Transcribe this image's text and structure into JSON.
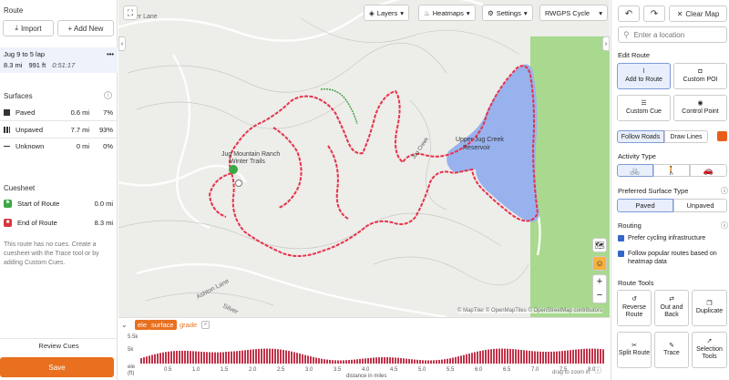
{
  "left": {
    "route_heading": "Route",
    "import_label": "Import",
    "add_new_label": "+ Add New",
    "route": {
      "name": "Jug 9 to 5 lap",
      "distance": "8.3 mi",
      "elevation": "991 ft",
      "time": "0:51:17",
      "menu": "•••"
    },
    "surfaces_heading": "Surfaces",
    "surfaces": [
      {
        "label": "Paved",
        "distance": "0.6 mi",
        "percent": "7%",
        "color": "#333333"
      },
      {
        "label": "Unpaved",
        "distance": "7.7 mi",
        "percent": "93%",
        "color": "#333333"
      },
      {
        "label": "Unknown",
        "distance": "0 mi",
        "percent": "0%",
        "color": "#333333"
      }
    ],
    "cuesheet_heading": "Cuesheet",
    "cues": [
      {
        "label": "Start of Route",
        "distance": "0.0 mi",
        "color": "#3aa845"
      },
      {
        "label": "End of Route",
        "distance": "8.3 mi",
        "color": "#d9363e"
      }
    ],
    "no_cues_text": "This route has no cues. Create a cuesheet with the Trace tool or by adding Custom Cues.",
    "review_cues_label": "Review Cues",
    "save_label": "Save"
  },
  "map": {
    "layers_label": "Layers",
    "heatmaps_label": "Heatmaps",
    "settings_label": "Settings",
    "map_style": "RWGPS Cycle",
    "labels": {
      "lane1": "ter Lane",
      "ranch": "Jug Mountain Ranch",
      "trails": "Winter Trails",
      "reservoir1": "Upper Jug Creek",
      "reservoir2": "Reservoir",
      "creek": "Jug Creek",
      "ashton": "Ashton Lane",
      "silver": "Silver"
    },
    "attribution": "© MapTiler © OpenMapTiles © OpenStreetMap contributors",
    "zoom_in": "+",
    "zoom_out": "−"
  },
  "elevation": {
    "tabs": [
      "ele",
      "surface",
      "grade"
    ],
    "y_ticks": [
      "5.5k",
      "5k"
    ],
    "y_unit": "(ft)",
    "y_axis_label": "ele",
    "x_ticks": [
      "0.5",
      "1.0",
      "1.5",
      "2.0",
      "2.5",
      "3.0",
      "3.5",
      "4.0",
      "4.5",
      "5.0",
      "5.5",
      "6.0",
      "6.5",
      "7.0",
      "7.5",
      "8.0"
    ],
    "x_label": "distance in miles",
    "hint": "drag to zoom in"
  },
  "right": {
    "undo": "↶",
    "redo": "↷",
    "clear_map_label": "Clear Map",
    "search_placeholder": "Enter a location",
    "edit_route_heading": "Edit Route",
    "tools_edit": [
      {
        "label": "Add to Route",
        "active": true
      },
      {
        "label": "Custom POI",
        "active": false
      },
      {
        "label": "Custom Cue",
        "active": false
      },
      {
        "label": "Control Point",
        "active": false
      }
    ],
    "follow_roads_label": "Follow Roads",
    "draw_lines_label": "Draw Lines",
    "route_color": "#e85d1c",
    "activity_type_heading": "Activity Type",
    "preferred_surface_heading": "Preferred Surface Type",
    "paved_label": "Paved",
    "unpaved_label": "Unpaved",
    "routing_heading": "Routing",
    "routing_options": [
      "Prefer cycling infrastructure",
      "Follow popular routes based on heatmap data"
    ],
    "route_tools_heading": "Route Tools",
    "route_tools": [
      {
        "label": "Reverse Route"
      },
      {
        "label": "Out and Back"
      },
      {
        "label": "Duplicate"
      },
      {
        "label": "Split Route"
      },
      {
        "label": "Trace"
      },
      {
        "label": "Selection Tools"
      }
    ]
  },
  "colors": {
    "route": "#e8324a",
    "water": "#98b2ee",
    "park": "#a8d98e",
    "accent": "#e8701f"
  }
}
